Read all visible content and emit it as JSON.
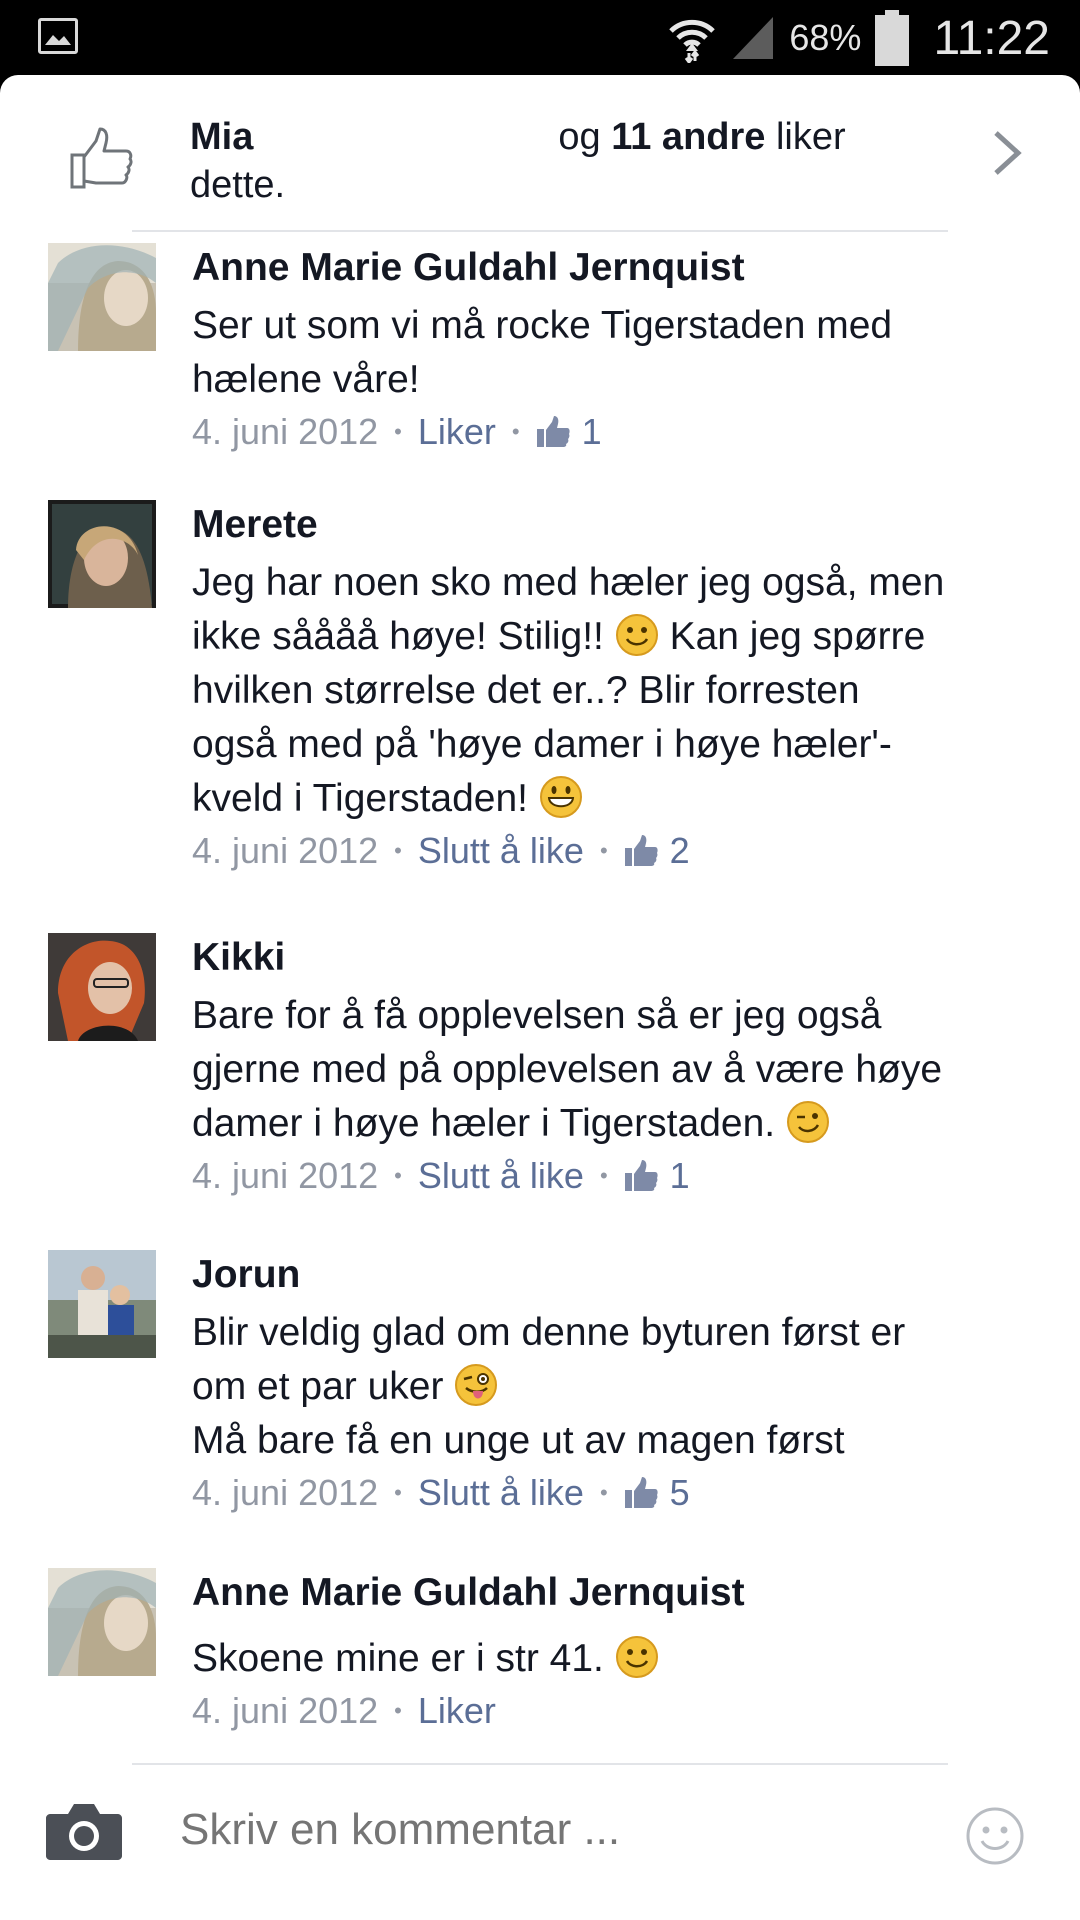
{
  "status_bar": {
    "battery_percent": "68%",
    "time": "11:22"
  },
  "likes": {
    "name": "Mia",
    "middle": "og",
    "others": "11 andre",
    "suffix": "liker",
    "line2": "dette."
  },
  "comments": [
    {
      "author": "Anne Marie Guldahl Jernquist",
      "lines": [
        "Ser ut som vi må rocke Tigerstaden med",
        "hælene våre!"
      ],
      "date": "4. juni 2012",
      "action": "Liker",
      "likes": "1"
    },
    {
      "author": "Merete",
      "lines": [
        "Jeg har noen sko med hæler jeg også, men",
        "ikke såååå høye! Stilig!!",
        "Kan jeg spørre",
        "hvilken størrelse det er..? Blir forresten",
        "også med på 'høye damer i høye hæler'-",
        "kveld i Tigerstaden!"
      ],
      "date": "4. juni 2012",
      "action": "Slutt å like",
      "likes": "2"
    },
    {
      "author": "Kikki",
      "lines": [
        "Bare for å få opplevelsen så er jeg også",
        "gjerne med på opplevelsen av å være høye",
        "damer i høye hæler i Tigerstaden."
      ],
      "date": "4. juni 2012",
      "action": "Slutt å like",
      "likes": "1"
    },
    {
      "author": "Jorun",
      "lines": [
        "Blir veldig glad om denne byturen først er",
        "om et par uker",
        "Må bare få en unge ut av magen først"
      ],
      "date": "4. juni 2012",
      "action": "Slutt å like",
      "likes": "5"
    },
    {
      "author": "Anne Marie Guldahl Jernquist",
      "lines": [
        "Skoene mine er i str 41."
      ],
      "date": "4. juni 2012",
      "action": "Liker"
    }
  ],
  "composer": {
    "placeholder": "Skriv en kommentar ..."
  },
  "colors": {
    "link": "#5b6e96",
    "meta": "#9197a3",
    "text": "#141823",
    "emoji": "#f5c33b"
  }
}
